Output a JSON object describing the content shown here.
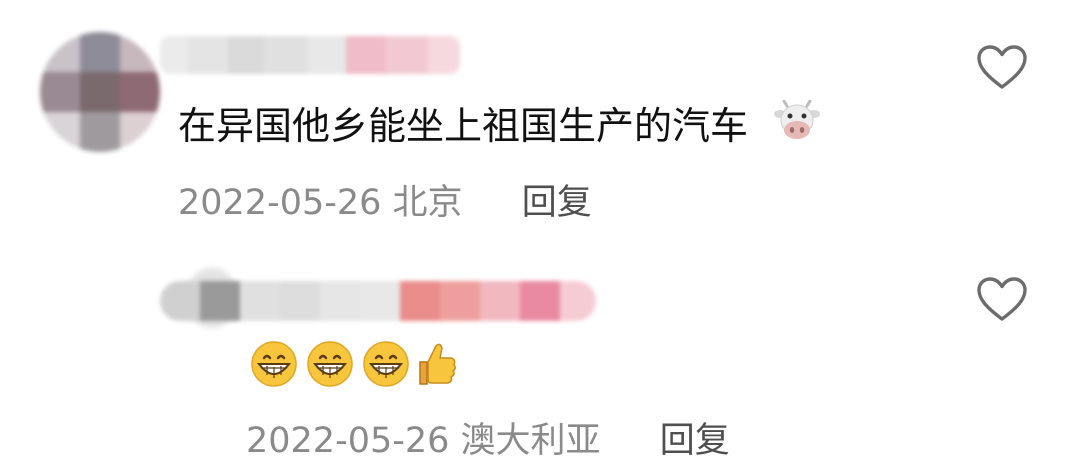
{
  "comments": [
    {
      "text": "在异国他乡能坐上祖国生产的汽车",
      "emoji": "cow-face",
      "date": "2022-05-26",
      "location": "北京",
      "reply_label": "回复"
    },
    {
      "emojis": [
        "grinning-face",
        "grinning-face",
        "grinning-face",
        "thumbs-up"
      ],
      "date": "2022-05-26",
      "location": "澳大利亚",
      "reply_label": "回复"
    }
  ],
  "colors": {
    "text": "#111111",
    "meta": "#8a8a8a",
    "reply": "#4e4e4e",
    "heart": "#6d6d6d"
  }
}
